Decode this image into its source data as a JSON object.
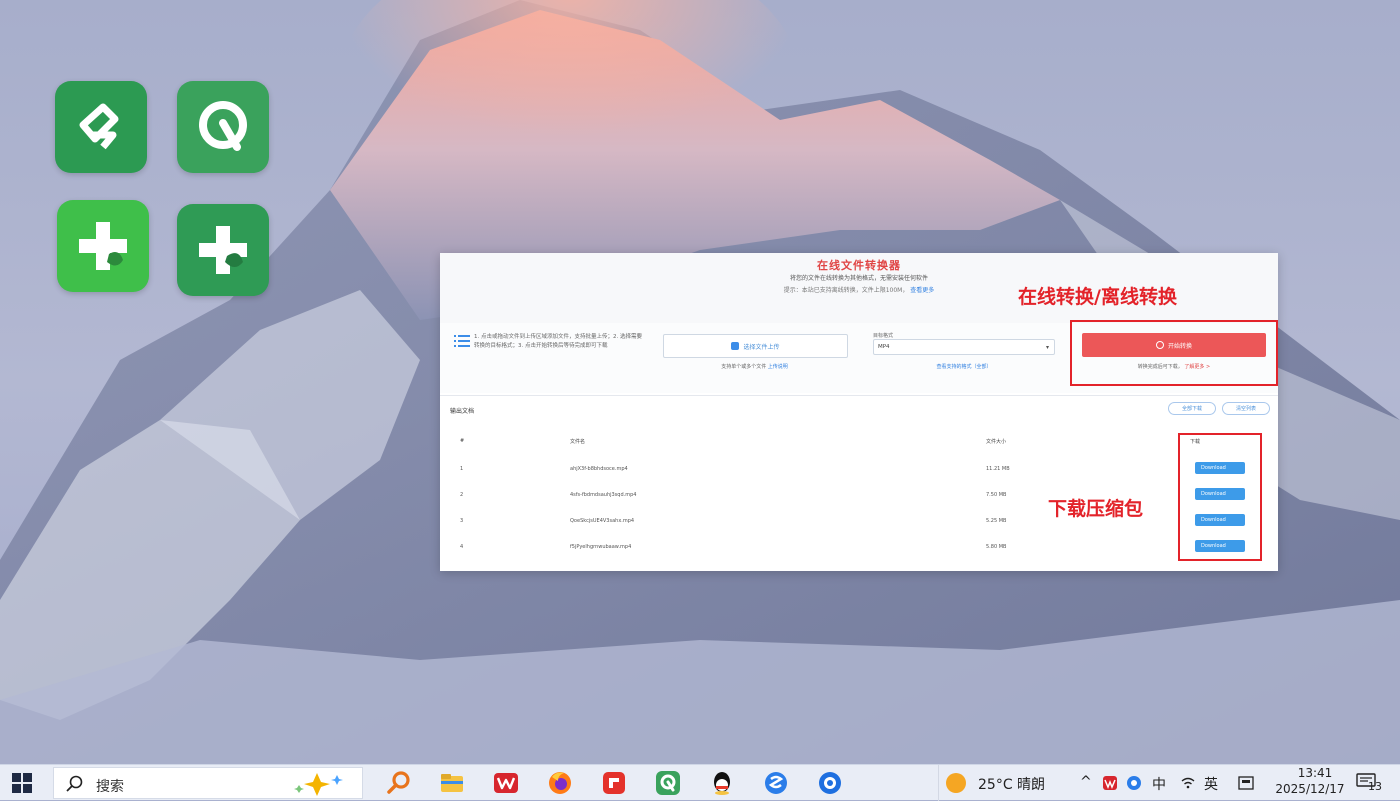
{
  "desktop": {
    "icons": [
      {
        "name": "app-dingtalk-like",
        "label": ""
      },
      {
        "name": "app-r-logo",
        "label": ""
      },
      {
        "name": "app-green-cross-1",
        "label": ""
      },
      {
        "name": "app-green-cross-2",
        "label": ""
      }
    ]
  },
  "page": {
    "title": "在线文件转换器",
    "subtitle": "将您的文件在线转换为其他格式，无需安装任何软件",
    "note_prefix": "提示：本站已支持离线转换，文件上限100M，",
    "note_link": "查看更多",
    "instructions": "1. 点击或拖动文件到上传区域添加文件，支持批量上传；2. 选择需要转换的目标格式；3. 点击开始转换后等待完成即可下载",
    "upload_button": "选择文件上传",
    "upload_hint_prefix": "支持单个或多个文件",
    "upload_hint_link": "上传说明",
    "format_label": "目标格式",
    "format_value": "MP4",
    "format_hint": "查看支持的格式（全部）",
    "convert_button": "开始转换",
    "convert_hint_prefix": "转换完成后可下载，",
    "convert_hint_link": "了解更多 >",
    "list_title": "输出文档",
    "pill_buttons": [
      "全部下载",
      "清空列表"
    ],
    "columns": {
      "index": "#",
      "name": "文件名",
      "size": "文件大小",
      "download": "下载"
    },
    "rows": [
      {
        "index": "1",
        "name": "ahjX3f-b8bhdsoce.mp4",
        "size": "11.21 MB",
        "download": "Download"
      },
      {
        "index": "2",
        "name": "4sfs-fbdmdsauhj3sqd.mp4",
        "size": "7.50 MB",
        "download": "Download"
      },
      {
        "index": "3",
        "name": "QoeSkcjsUE4V3sahx.mp4",
        "size": "5.25 MB",
        "download": "Download"
      },
      {
        "index": "4",
        "name": "f5jPyelhgrnwubaaw.mp4",
        "size": "5.80 MB",
        "download": "Download"
      }
    ]
  },
  "annotations": {
    "convert": "在线转换/离线转换",
    "download": "下载压缩包"
  },
  "taskbar": {
    "search_placeholder": "搜索",
    "weather": "25°C  晴朗",
    "tray_caret": "^",
    "tray_lang_zh": "中",
    "tray_lang_en": "英",
    "time": "13:41",
    "date": "2025/12/17",
    "notification_count": "13"
  },
  "colors": {
    "accent_red": "#e3232a",
    "convert_red": "#ec5758",
    "download_blue": "#3d9be9",
    "taskbar_bg": "#e9edf6"
  }
}
